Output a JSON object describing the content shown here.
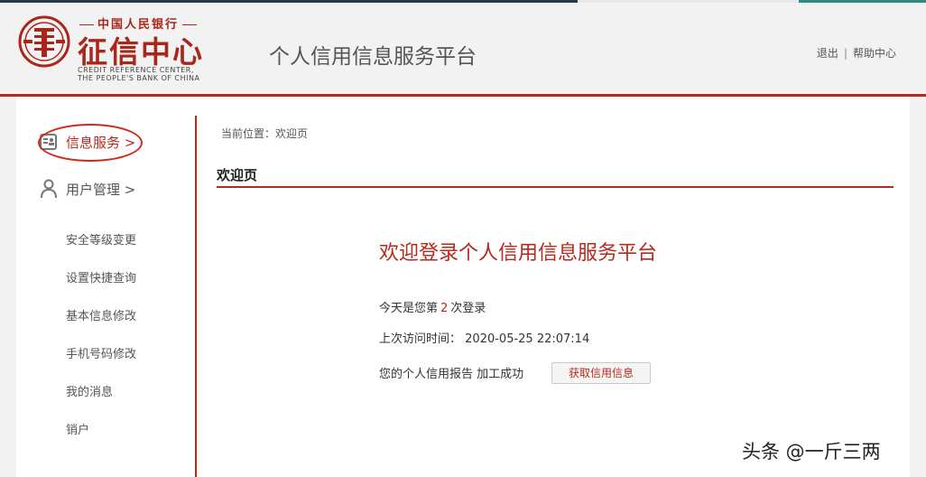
{
  "header": {
    "logo_top": "中国人民银行",
    "logo_main": "征信中心",
    "logo_en_line1": "CREDIT REFERENCE CENTER,",
    "logo_en_line2": "THE PEOPLE'S BANK OF CHINA",
    "platform_title": "个人信用信息服务平台",
    "links": {
      "logout": "退出",
      "separator": "|",
      "help": "帮助中心"
    }
  },
  "sidebar": {
    "items": [
      {
        "label": "信息服务 >",
        "icon": "id-card-icon",
        "active": true
      },
      {
        "label": "用户管理 >",
        "icon": "user-icon",
        "active": false
      }
    ],
    "subitems": [
      "安全等级变更",
      "设置快捷查询",
      "基本信息修改",
      "手机号码修改",
      "我的消息",
      "销户"
    ]
  },
  "main": {
    "breadcrumb": "当前位置：欢迎页",
    "heading": "欢迎页",
    "welcome_title": "欢迎登录个人信用信息服务平台",
    "login_count_prefix": "今天是您第",
    "login_count": "2",
    "login_count_suffix": "次登录",
    "last_visit_label": "上次访问时间：",
    "last_visit_time": "2020-05-25 22:07:14",
    "report_status": "您的个人信用报告 加工成功",
    "fetch_button": "获取信用信息"
  },
  "watermark": "头条 @一斤三两",
  "colors": {
    "accent": "#b52a1d",
    "header_bg": "#f2f2f2",
    "annotation": "#d4281c"
  }
}
